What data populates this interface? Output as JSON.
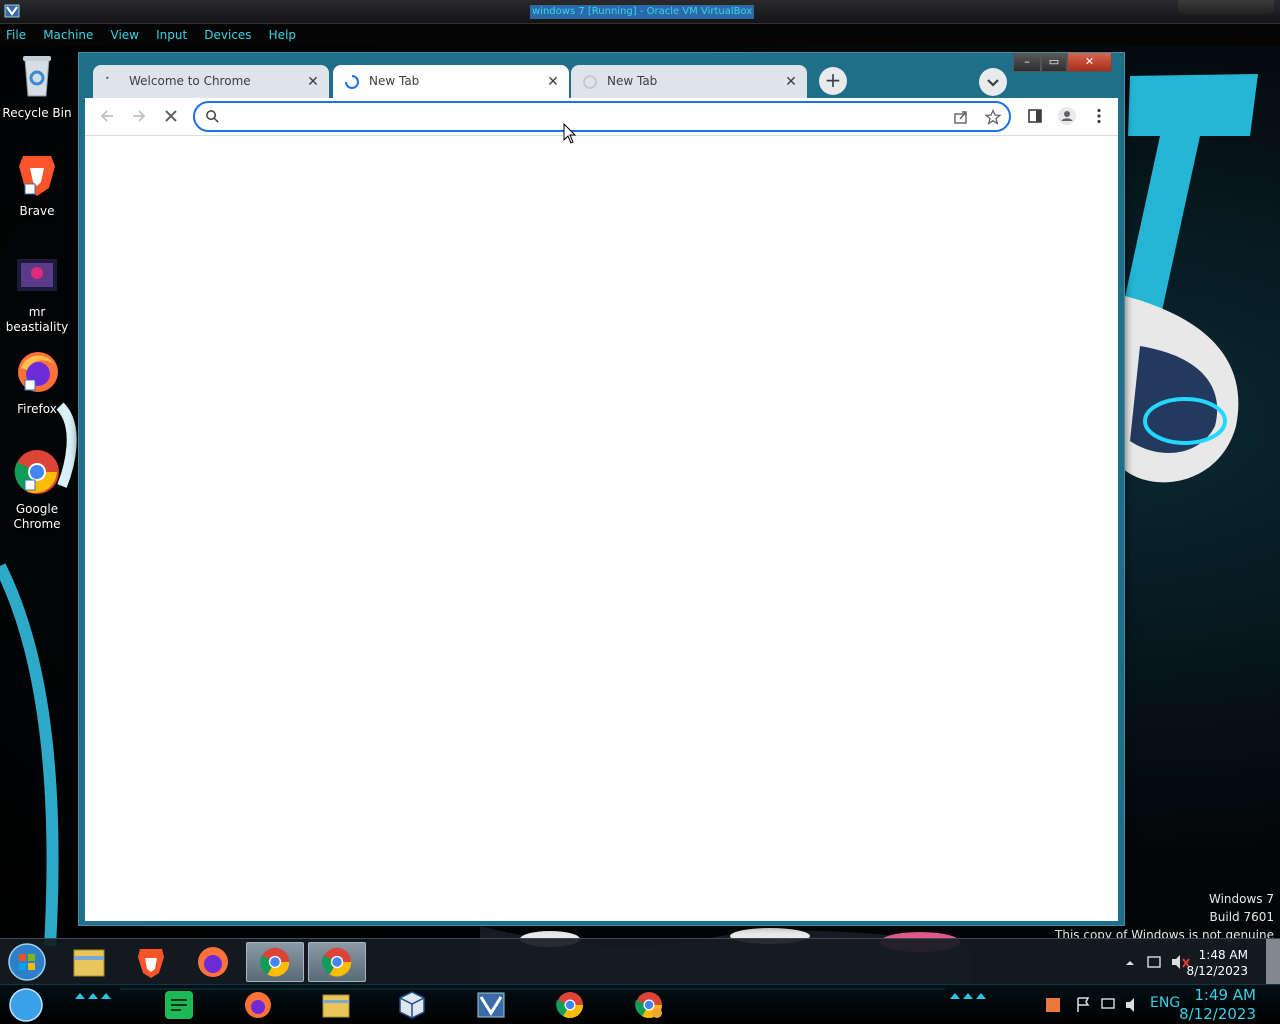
{
  "host": {
    "title": "windows 7 [Running] - Oracle VM VirtualBox",
    "menu": [
      "File",
      "Machine",
      "View",
      "Input",
      "Devices",
      "Help"
    ]
  },
  "desktop": {
    "icons": [
      {
        "name": "recycle-bin",
        "label": "Recycle Bin",
        "icon": "recycle-bin-icon"
      },
      {
        "name": "brave",
        "label": "Brave",
        "icon": "brave-icon"
      },
      {
        "name": "folder",
        "label": "mr beastiality",
        "icon": "folder-thumbnail-icon"
      },
      {
        "name": "firefox",
        "label": "Firefox",
        "icon": "firefox-icon"
      },
      {
        "name": "chrome",
        "label": "Google Chrome",
        "icon": "chrome-icon"
      }
    ],
    "watermark": {
      "line1": "Windows 7",
      "line2": "Build 7601",
      "line3": "This copy of Windows is not genuine"
    }
  },
  "browser": {
    "tabs": [
      {
        "label": "Welcome to Chrome",
        "state": "inactive"
      },
      {
        "label": "New Tab",
        "state": "active-loading"
      },
      {
        "label": "New Tab",
        "state": "inactive-loading"
      }
    ],
    "omnibox": {
      "value": "",
      "placeholder": ""
    },
    "accent": "#1a73e8"
  },
  "taskbar": {
    "apps": [
      "file-explorer",
      "brave",
      "firefox",
      "chrome",
      "chrome"
    ],
    "time": "1:48 AM",
    "date": "8/12/2023"
  },
  "dock": {
    "language": "ENG",
    "time": "1:49 AM",
    "date": "8/12/2023"
  }
}
